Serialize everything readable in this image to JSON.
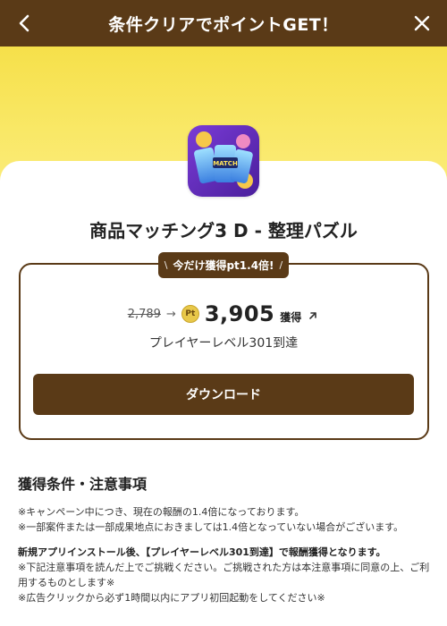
{
  "header": {
    "title": "条件クリアでポイントGET！",
    "back_icon": "chevron-left-icon",
    "close_icon": "close-icon"
  },
  "colors": {
    "brand": "#5a3a17",
    "hero_yellow": "#f6e04a",
    "coin": "#e8c84a"
  },
  "app": {
    "name": "商品マッチング3 D - 整理パズル",
    "icon_text": "MATCH"
  },
  "reward": {
    "badge": "今だけ獲得pt1.4倍!",
    "old_points": "2,789",
    "coin_label": "Pt",
    "new_points": "3,905",
    "points_suffix": "獲得",
    "condition": "プレイヤーレベル301到達",
    "download_label": "ダウンロード"
  },
  "notes": {
    "title": "獲得条件・注意事項",
    "lines": [
      "※キャンペーン中につき、現在の報酬の1.4倍になっております。",
      "※一部案件または一部成果地点におきましては1.4倍となっていない場合がございます。"
    ],
    "strong_line": "新規アプリインストール後、【プレイヤーレベル301到達】で報酬獲得となります。",
    "lines2": [
      "※下記注意事項を読んだ上でご挑戦ください。ご挑戦された方は本注意事項に同意の上、ご利用するものとします※",
      "※広告クリックから必ず1時間以内にアプリ初回起動をしてください※"
    ]
  }
}
